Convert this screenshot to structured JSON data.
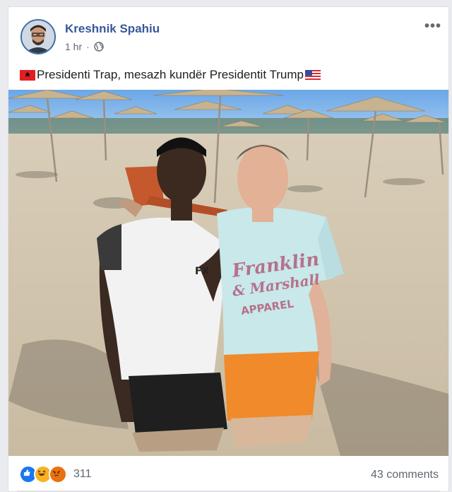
{
  "post": {
    "author": "Kreshnik Spahiu",
    "time": "1 hr",
    "time_separator": "·",
    "privacy_icon": "globe-icon",
    "more_label": "•••",
    "caption": "Presidenti Trap, mesazh kundër Presidentit Trump",
    "caption_prefix_icon": "albania-flag-icon",
    "caption_suffix_icon": "usa-flag-icon",
    "photo_text": {
      "shirt_line1": "Franklin",
      "shirt_line2": "& Marshall",
      "shirt_line3": "APPAREL",
      "sleeve_logo": "FX"
    }
  },
  "footer": {
    "reactions": [
      "like-icon",
      "haha-icon",
      "angry-icon"
    ],
    "reaction_count": "311",
    "comments": "43 comments"
  },
  "colors": {
    "link": "#385898",
    "secondary": "#606770",
    "like": "#1877f2",
    "haha": "#f7b125",
    "angry": "#e9710f"
  }
}
